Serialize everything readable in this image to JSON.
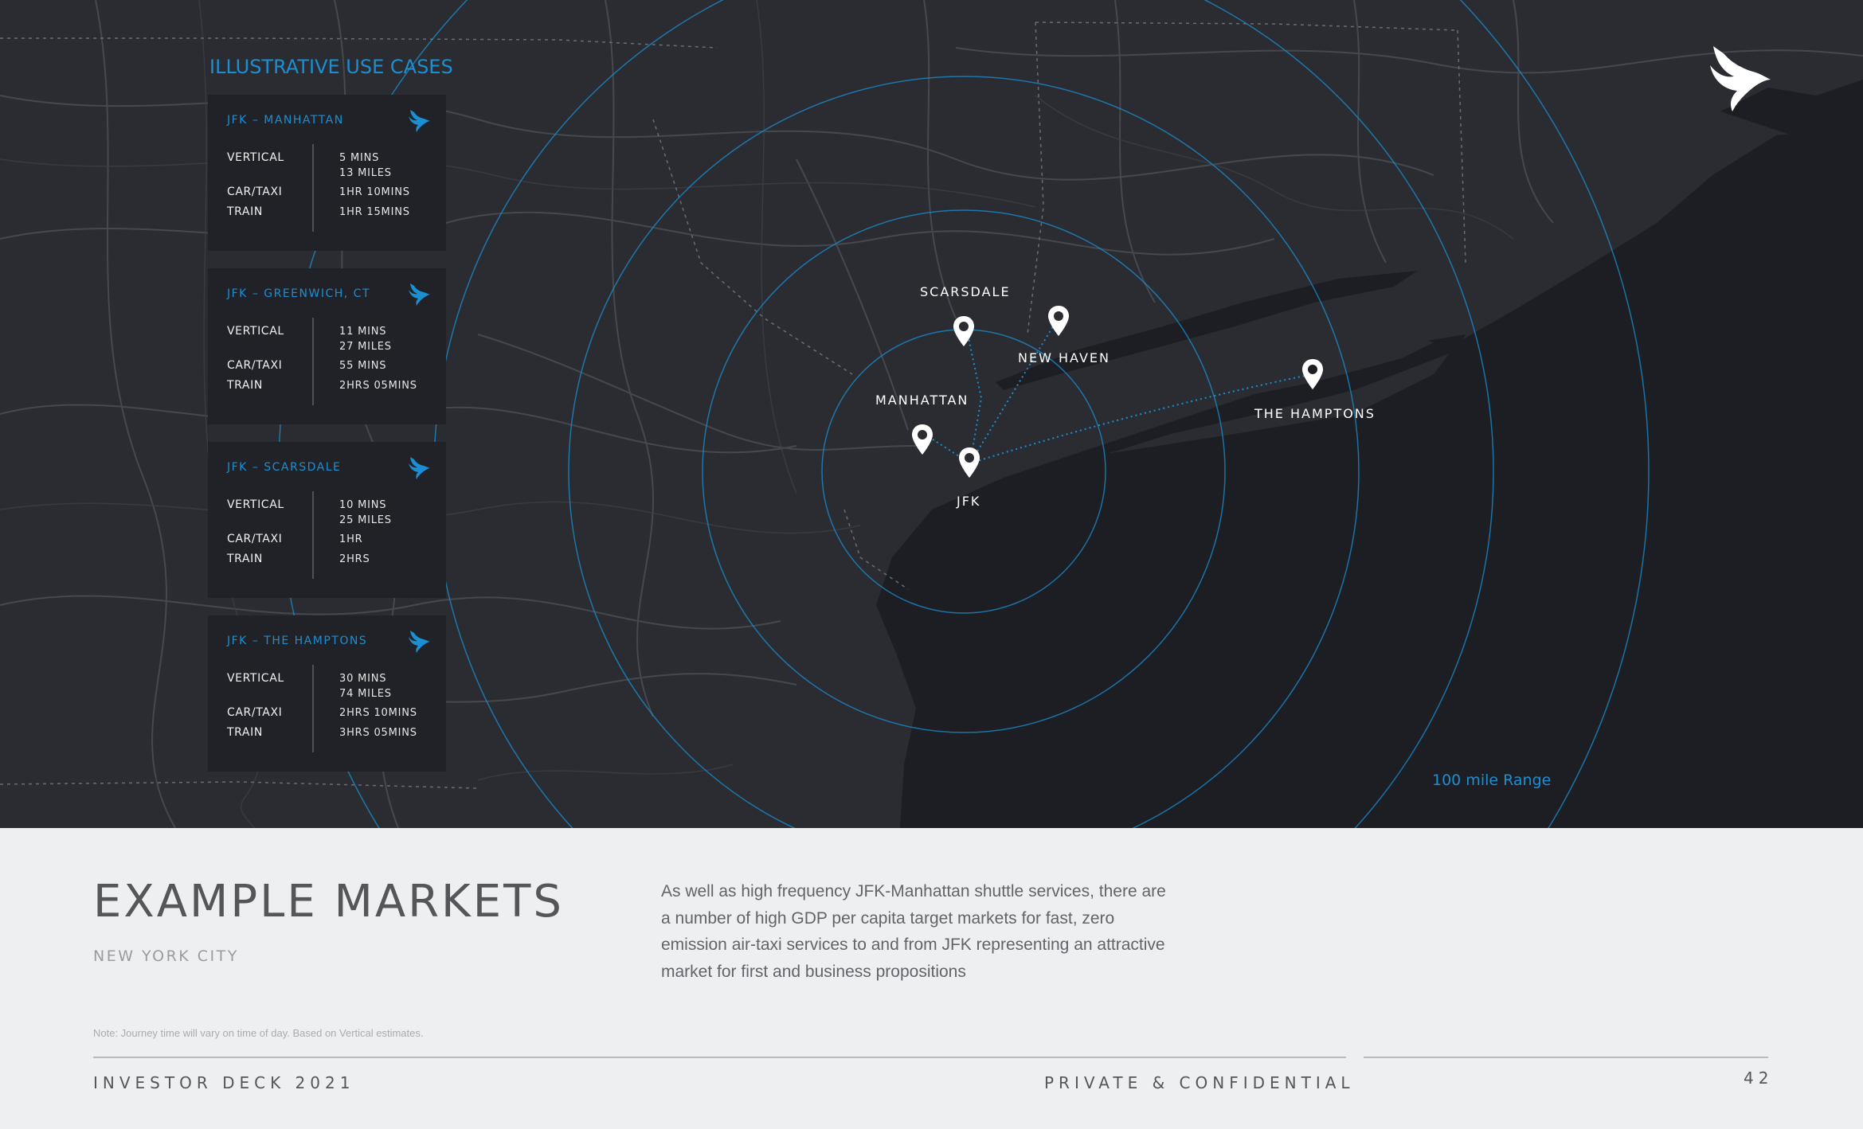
{
  "section_title": "ILLUSTRATIVE USE CASES",
  "cards": [
    {
      "title": "JFK – MANHATTAN",
      "rows": [
        {
          "label": "VERTICAL",
          "value": "5 MINS",
          "value2": "13 MILES"
        },
        {
          "label": "CAR/TAXI",
          "value": "1HR 10MINS"
        },
        {
          "label": "TRAIN",
          "value": "1HR 15MINS"
        }
      ]
    },
    {
      "title": "JFK – GREENWICH, CT",
      "rows": [
        {
          "label": "VERTICAL",
          "value": "11 MINS",
          "value2": "27 MILES"
        },
        {
          "label": "CAR/TAXI",
          "value": "55 MINS"
        },
        {
          "label": "TRAIN",
          "value": "2HRS 05MINS"
        }
      ]
    },
    {
      "title": "JFK – SCARSDALE",
      "rows": [
        {
          "label": "VERTICAL",
          "value": "10 MINS",
          "value2": "25 MILES"
        },
        {
          "label": "CAR/TAXI",
          "value": "1HR"
        },
        {
          "label": "TRAIN",
          "value": "2HRS"
        }
      ]
    },
    {
      "title": "JFK – THE HAMPTONS",
      "rows": [
        {
          "label": "VERTICAL",
          "value": "30 MINS",
          "value2": "74 MILES"
        },
        {
          "label": "CAR/TAXI",
          "value": "2HRS 10MINS"
        },
        {
          "label": "TRAIN",
          "value": "3HRS 05MINS"
        }
      ]
    }
  ],
  "map": {
    "locations": [
      "SCARSDALE",
      "NEW HAVEN",
      "MANHATTAN",
      "THE HAMPTONS",
      "JFK"
    ],
    "range_label": "100 mile Range"
  },
  "colors": {
    "accent": "#1b8fd2",
    "map_land": "#2a2c32",
    "map_water": "#1c1e23",
    "card_bg": "#202228"
  },
  "icons": [
    "bird-logo-icon",
    "map-pin-icon"
  ],
  "title": "EXAMPLE MARKETS",
  "subtitle": "NEW YORK CITY",
  "description": "As well as high frequency JFK-Manhattan shuttle services, there are a number of high GDP per capita target markets for fast, zero emission air-taxi services to and from JFK representing an attractive market for first and business propositions",
  "note": "Note: Journey time will vary on time of day. Based on Vertical estimates.",
  "footer": {
    "left": "INVESTOR DECK 2021",
    "center": "PRIVATE & CONFIDENTIAL",
    "page": "42"
  }
}
